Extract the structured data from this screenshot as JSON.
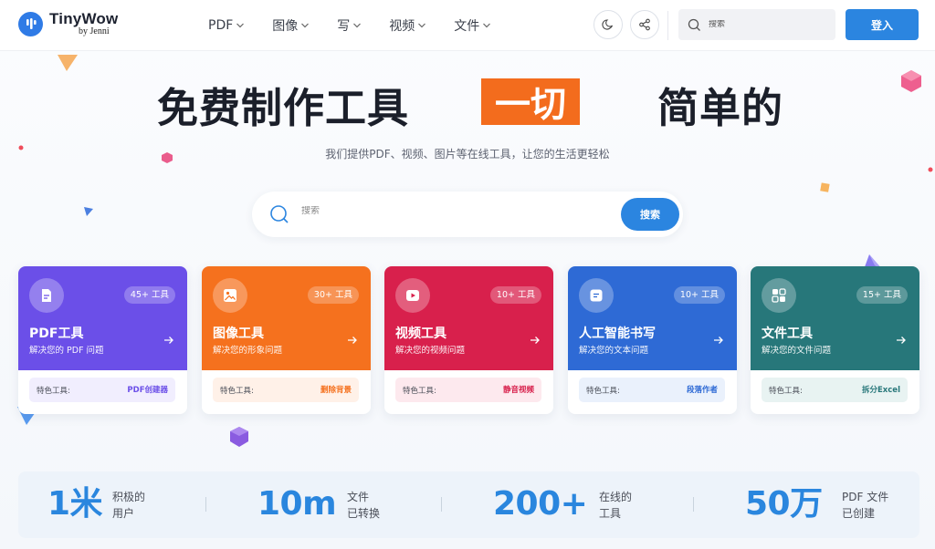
{
  "header": {
    "logo_title": "TinyWow",
    "logo_sub": "by Jenni",
    "nav": [
      "PDF",
      "图像",
      "写",
      "视频",
      "文件"
    ],
    "search_placeholder": "搜索",
    "login_label": "登入"
  },
  "hero": {
    "title_left": "免费制作工具",
    "title_highlight": "一切",
    "title_right": "简单的",
    "subtitle": "我们提供PDF、视频、图片等在线工具，让您的生活更轻松",
    "search_placeholder": "搜索",
    "search_button": "搜索"
  },
  "cards": [
    {
      "title": "PDF工具",
      "desc": "解决您的 PDF 问题",
      "count": "45+ 工具",
      "feature_label": "特色工具:",
      "feature": "PDF创建器",
      "color": "#6b4fe8",
      "icon": "pdf-file-icon"
    },
    {
      "title": "图像工具",
      "desc": "解决您的形象问题",
      "count": "30+ 工具",
      "feature_label": "特色工具:",
      "feature": "删除背景",
      "color": "#f5711e",
      "icon": "image-icon"
    },
    {
      "title": "视频工具",
      "desc": "解决您的视频问题",
      "count": "10+ 工具",
      "feature_label": "特色工具:",
      "feature": "静音视频",
      "color": "#d8204c",
      "icon": "video-icon"
    },
    {
      "title": "人工智能书写",
      "desc": "解决您的文本问题",
      "count": "10+ 工具",
      "feature_label": "特色工具:",
      "feature": "段落作者",
      "color": "#2e6ad5",
      "icon": "document-text-icon"
    },
    {
      "title": "文件工具",
      "desc": "解决您的文件问题",
      "count": "15+ 工具",
      "feature_label": "特色工具:",
      "feature": "拆分Excel",
      "color": "#27777a",
      "icon": "file-convert-icon"
    }
  ],
  "stats": [
    {
      "value": "1米",
      "label_line1": "积极的",
      "label_line2": "用户"
    },
    {
      "value": "10m",
      "label_line1": "文件",
      "label_line2": "已转换"
    },
    {
      "value": "200+",
      "label_line1": "在线的",
      "label_line2": "工具"
    },
    {
      "value": "50万",
      "label_line1": "PDF 文件",
      "label_line2": "已创建"
    }
  ],
  "colors": {
    "accent": "#2b85e0",
    "highlight": "#f36c1d"
  }
}
